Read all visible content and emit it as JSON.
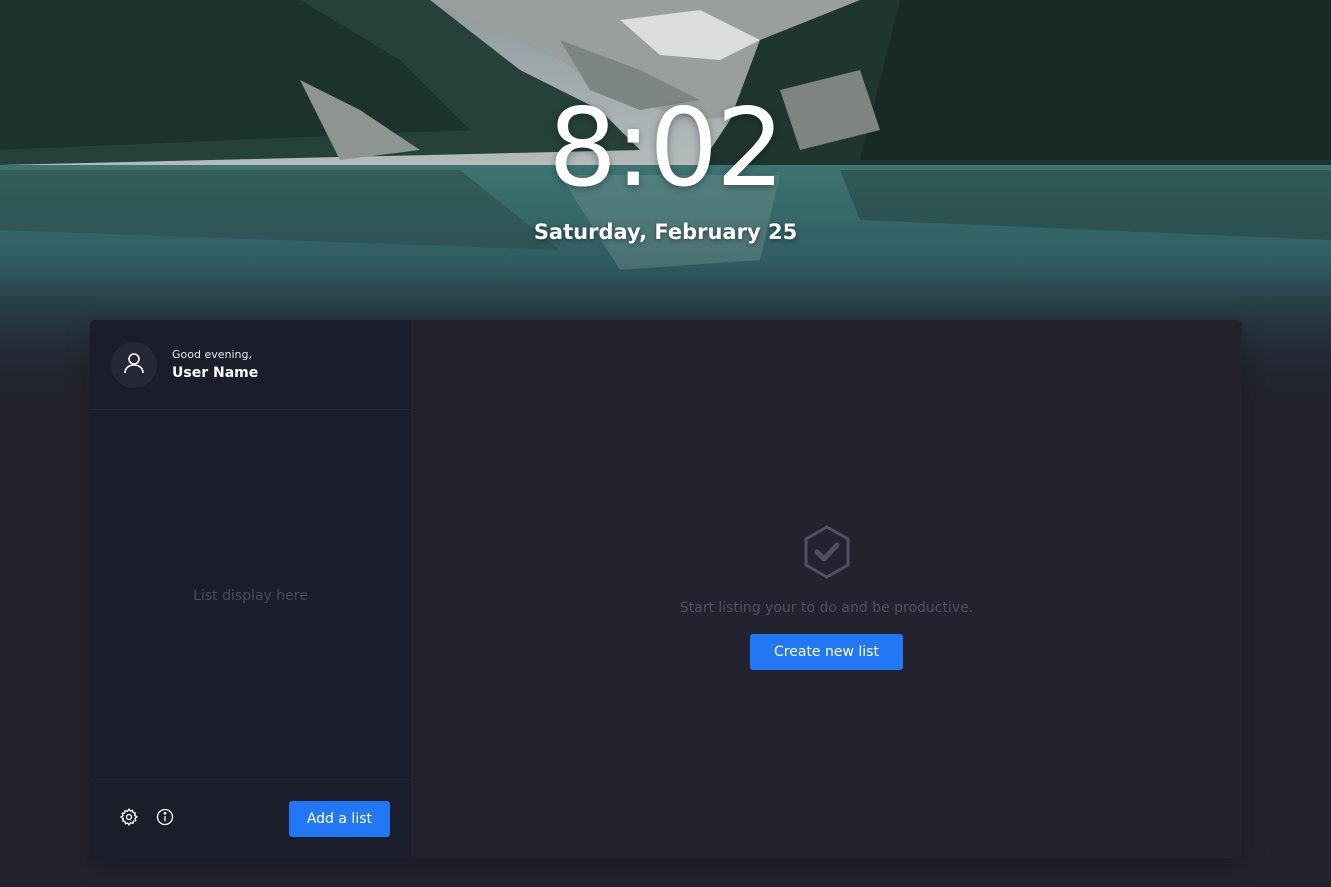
{
  "clock": {
    "time": "8:02",
    "date": "Saturday, February 25"
  },
  "sidebar": {
    "greeting": "Good evening,",
    "user_name": "User Name",
    "list_placeholder": "List display here",
    "add_list_label": "Add a list",
    "icons": [
      "user-icon",
      "gear-icon",
      "info-icon"
    ]
  },
  "main": {
    "empty_icon": "check-hexagon-icon",
    "empty_message": "Start listing your to do and be productive.",
    "create_label": "Create new list"
  },
  "colors": {
    "accent": "#2277f5",
    "background": "#22232f",
    "sidebar": "#1c1d2b"
  }
}
